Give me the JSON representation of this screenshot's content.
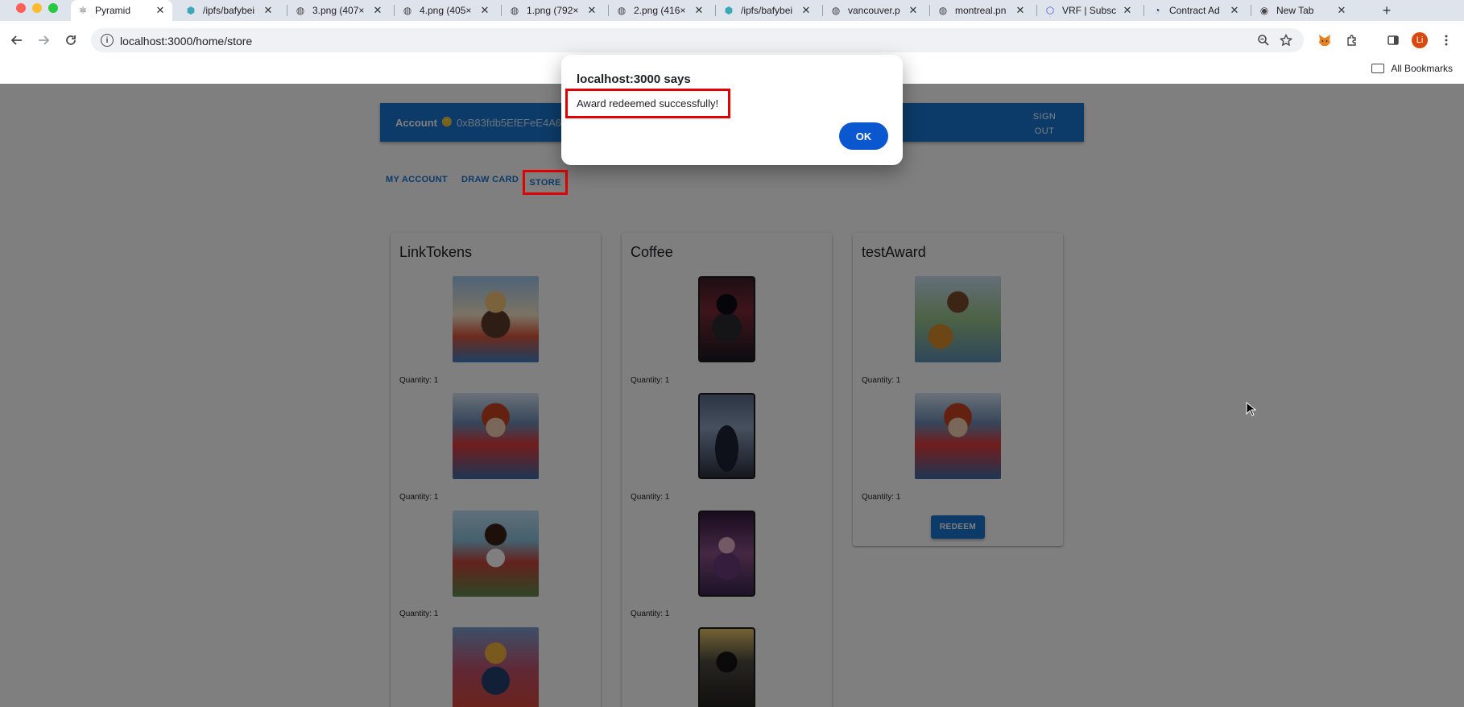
{
  "browser": {
    "tabs": [
      {
        "label": "Pyramid",
        "icon": "react-icon",
        "active": true
      },
      {
        "label": "/ipfs/bafybei",
        "icon": "ipfs-cube-icon"
      },
      {
        "label": "3.png (407×",
        "icon": "globe-icon"
      },
      {
        "label": "4.png (405×",
        "icon": "globe-icon"
      },
      {
        "label": "1.png (792×",
        "icon": "globe-icon"
      },
      {
        "label": "2.png (416×",
        "icon": "globe-icon"
      },
      {
        "label": "/ipfs/bafybei",
        "icon": "ipfs-cube-icon"
      },
      {
        "label": "vancouver.p",
        "icon": "globe-icon"
      },
      {
        "label": "montreal.pn",
        "icon": "globe-icon"
      },
      {
        "label": "VRF | Subsc",
        "icon": "chainlink-hex-icon"
      },
      {
        "label": "Contract Ad",
        "icon": "etherscan-icon"
      },
      {
        "label": "New Tab",
        "icon": "chrome-icon"
      }
    ],
    "url": "localhost:3000/home/store",
    "profile_initial": "Li",
    "bookmarks_label": "All Bookmarks"
  },
  "app": {
    "account_label": "Account",
    "account_address": "0xB83fdb5EfEFeE4A69",
    "sign_out": "SIGN OUT",
    "nav": {
      "my_account": "MY ACCOUNT",
      "draw_card": "DRAW CARD",
      "store": "STORE"
    },
    "cards": [
      {
        "title": "LinkTokens",
        "items": [
          {
            "quantity": "Quantity: 1"
          },
          {
            "quantity": "Quantity: 1"
          },
          {
            "quantity": "Quantity: 1"
          },
          {
            "quantity": ""
          }
        ]
      },
      {
        "title": "Coffee",
        "items": [
          {
            "quantity": "Quantity: 1"
          },
          {
            "quantity": "Quantity: 1"
          },
          {
            "quantity": "Quantity: 1"
          },
          {
            "quantity": ""
          }
        ]
      },
      {
        "title": "testAward",
        "items": [
          {
            "quantity": "Quantity: 1"
          },
          {
            "quantity": "Quantity: 1"
          }
        ],
        "button": "REDEEM"
      }
    ]
  },
  "alert": {
    "title": "localhost:3000 says",
    "message": "Award redeemed successfully!",
    "ok": "OK"
  },
  "colors": {
    "primary": "#1976d2",
    "highlight": "#e00000",
    "dialog_ok": "#0b57d0"
  }
}
